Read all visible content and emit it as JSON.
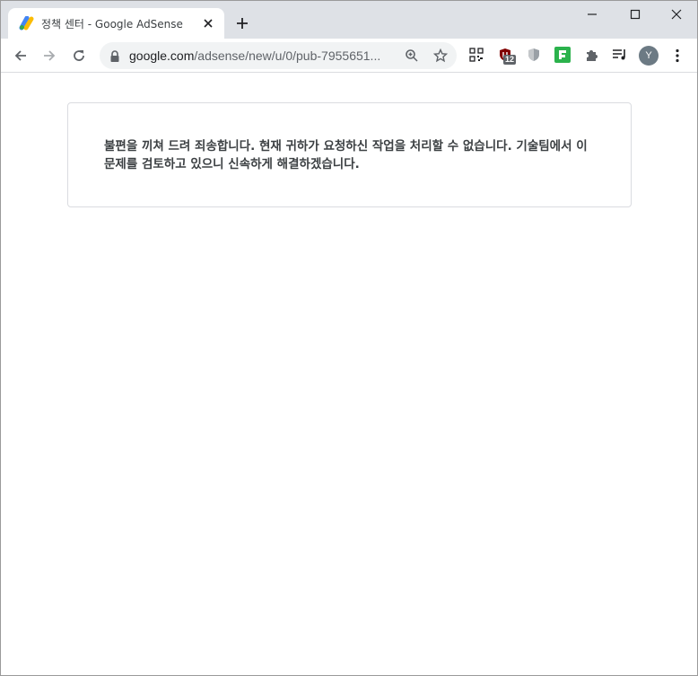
{
  "tab": {
    "title": "정책 센터 - Google AdSense",
    "favicon": "adsense-icon"
  },
  "toolbar": {
    "url_host": "google.com",
    "url_path": "/adsense/new/u/0/pub-7955651...",
    "extension_badge": "12",
    "avatar_letter": "Y"
  },
  "page": {
    "error_message": "불편을 끼쳐 드려 죄송합니다. 현재 귀하가 요청하신 작업을 처리할 수 없습니다. 기술팀에서 이 문제를 검토하고 있으니 신속하게 해결하겠습니다."
  },
  "colors": {
    "tabstrip": "#dee1e6",
    "omnibox": "#f1f3f4",
    "text": "#3c4043",
    "card_border": "#dadce0"
  }
}
